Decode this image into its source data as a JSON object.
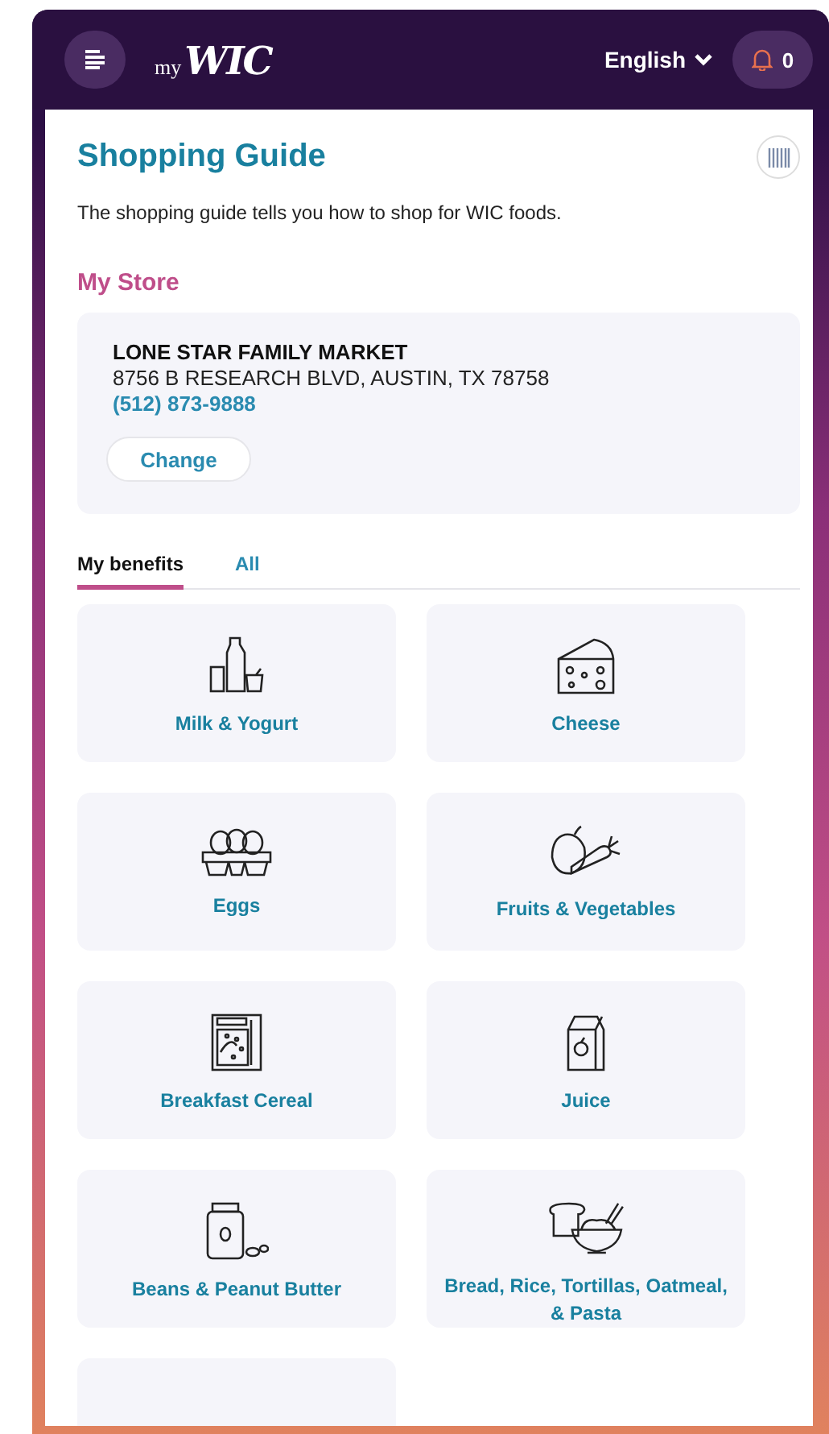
{
  "header": {
    "logo_prefix": "my",
    "logo_name": "WIC",
    "language": "English",
    "notifications": "0"
  },
  "page": {
    "title": "Shopping Guide",
    "description": "The shopping guide tells you how to shop for WIC foods."
  },
  "store": {
    "heading": "My Store",
    "name": "LONE STAR FAMILY MARKET",
    "address": "8756 B RESEARCH BLVD, AUSTIN, TX 78758",
    "phone": "(512) 873-9888",
    "button": "Change"
  },
  "tabs": [
    {
      "label": "My benefits",
      "selected": true
    },
    {
      "label": "All",
      "selected": false
    }
  ],
  "categories": [
    {
      "kind": "milk",
      "label": "Milk & Yogurt"
    },
    {
      "kind": "cheese",
      "label": "Cheese"
    },
    {
      "kind": "eggs",
      "label": "Eggs"
    },
    {
      "kind": "produce",
      "label": "Fruits & Vegetables"
    },
    {
      "kind": "cereal",
      "label": "Breakfast Cereal"
    },
    {
      "kind": "juice",
      "label": "Juice"
    },
    {
      "kind": "jar",
      "label": "Beans & Peanut Butter"
    },
    {
      "kind": "grains",
      "label": "Bread, Rice, Tortillas, Oatmeal, & Pasta"
    },
    {
      "kind": "cutoff"
    }
  ]
}
